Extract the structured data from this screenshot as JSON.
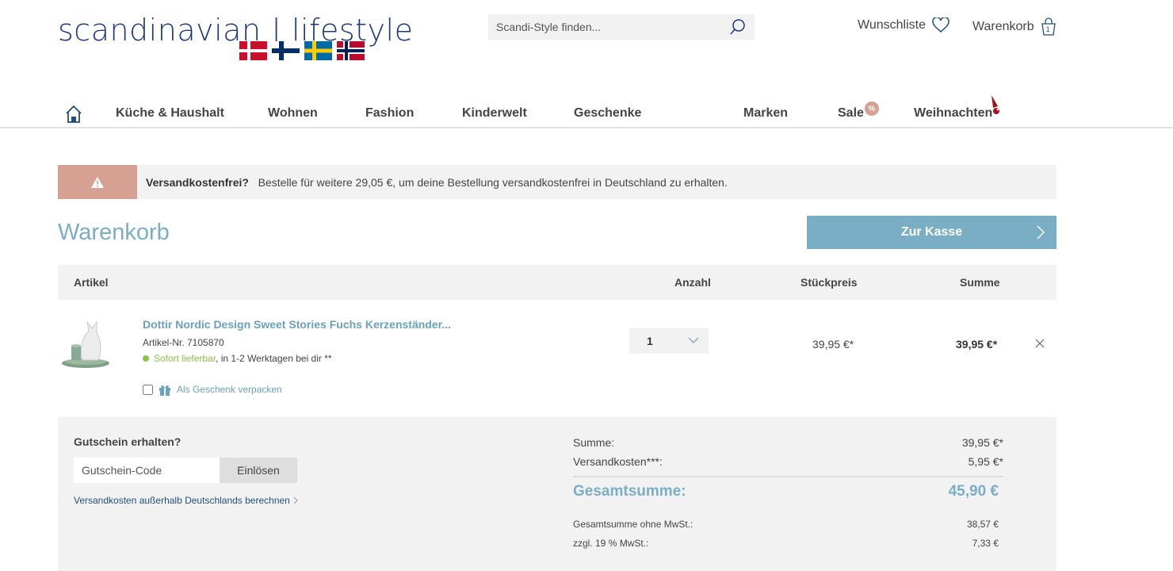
{
  "header": {
    "logo_text": "scandinavian | lifestyle",
    "search_placeholder": "Scandi-Style finden...",
    "wishlist_label": "Wunschliste",
    "cart_label": "Warenkorb",
    "cart_count": "1"
  },
  "nav": {
    "items": [
      "Küche & Haushalt",
      "Wohnen",
      "Fashion",
      "Kinderwelt",
      "Geschenke",
      "Marken",
      "Sale",
      "Weihnachten"
    ],
    "sale_badge": "%"
  },
  "notice": {
    "title": "Versandkostenfrei?",
    "text": "Bestelle für weitere 29,05 €, um deine Bestellung versandkostenfrei in Deutschland zu erhalten."
  },
  "page_title": "Warenkorb",
  "checkout_label": "Zur Kasse",
  "table": {
    "headers": {
      "article": "Artikel",
      "qty": "Anzahl",
      "unit_price": "Stückpreis",
      "total": "Summe"
    },
    "items": [
      {
        "name": "Dottir Nordic Design Sweet Stories Fuchs Kerzenständer...",
        "sku": "Artikel-Nr. 7105870",
        "stock_status": "Sofort lieferbar",
        "stock_delivery": ", in 1-2 Werktagen bei dir **",
        "gift_label": "Als Geschenk verpacken",
        "qty": "1",
        "unit_price": "39,95 €*",
        "total": "39,95 €*"
      }
    ]
  },
  "coupon": {
    "title": "Gutschein erhalten?",
    "placeholder": "Gutschein-Code",
    "button": "Einlösen",
    "shipping_link": "Versandkosten außerhalb Deutschlands berechnen"
  },
  "summary": {
    "subtotal_label": "Summe:",
    "subtotal": "39,95 €*",
    "shipping_label": "Versandkosten***:",
    "shipping": "5,95 €*",
    "grand_label": "Gesamtsumme:",
    "grand": "45,90 €",
    "net_label": "Gesamtsumme ohne MwSt.:",
    "net": "38,57 €",
    "vat_label": "zzgl. 19 % MwSt.:",
    "vat": "7,33 €"
  },
  "colors": {
    "accent": "#7aaec4",
    "notice": "#d6a092",
    "logo": "#1f3a7a",
    "panel": "#f2f2f2",
    "stock": "#8bc34a"
  }
}
